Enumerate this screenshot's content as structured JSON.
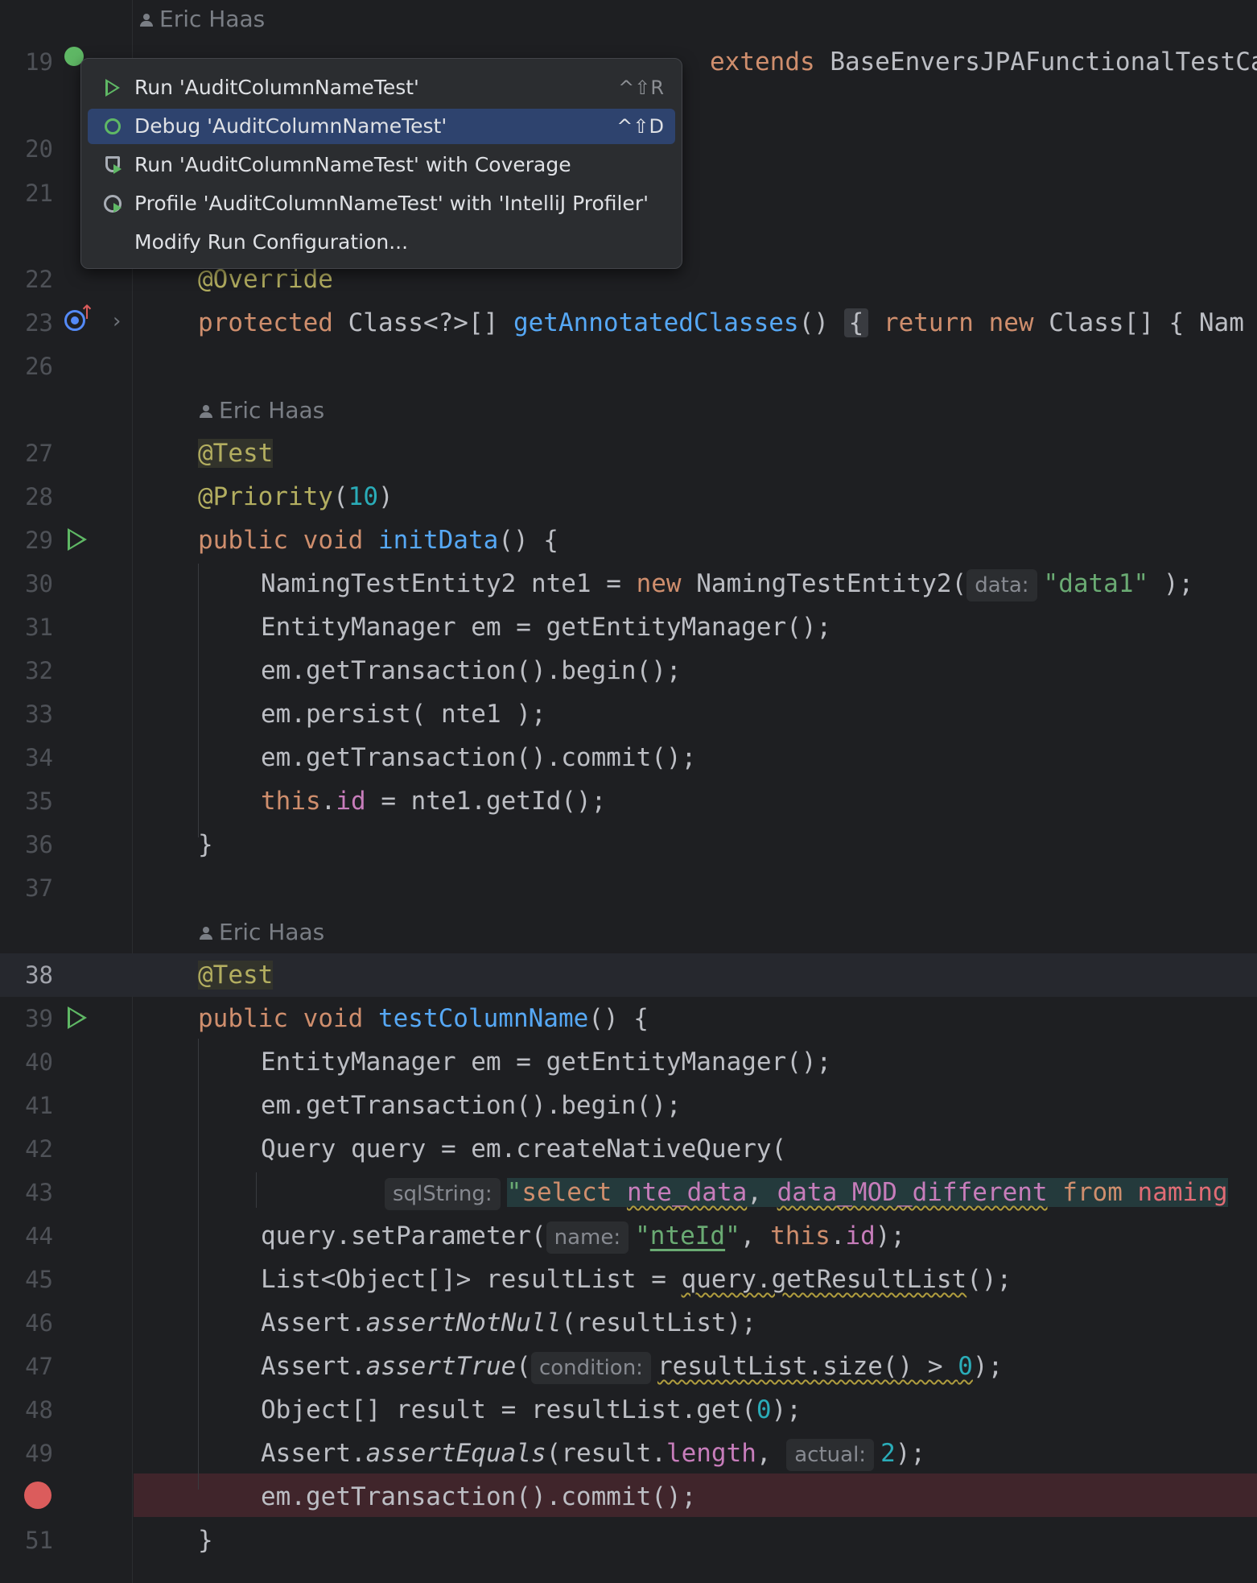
{
  "editor": {
    "author_name": "Eric Haas",
    "line_numbers": {
      "l19": "19",
      "l20": "20",
      "l21": "21",
      "l22": "22",
      "l23": "23",
      "l26": "26",
      "l27": "27",
      "l28": "28",
      "l29": "29",
      "l30": "30",
      "l31": "31",
      "l32": "32",
      "l33": "33",
      "l34": "34",
      "l35": "35",
      "l36": "36",
      "l37": "37",
      "l38": "38",
      "l39": "39",
      "l40": "40",
      "l41": "41",
      "l42": "42",
      "l43": "43",
      "l44": "44",
      "l45": "45",
      "l46": "46",
      "l47": "47",
      "l48": "48",
      "l49": "49",
      "l51": "51"
    },
    "code": {
      "l19_a": "extends",
      "l19_b": " BaseEnversJPAFunctionalTestCase",
      "l22": "@Override",
      "l23_a": "protected",
      "l23_b": " Class<?>[] ",
      "l23_c": "getAnnotatedClasses",
      "l23_d": "() ",
      "l23_e": "{",
      "l23_f": " ",
      "l23_g": "return",
      "l23_h": " ",
      "l23_i": "new",
      "l23_j": " Class[] { Nam",
      "l27": "@Test",
      "l28_a": "@Priority",
      "l28_b": "(",
      "l28_c": "10",
      "l28_d": ")",
      "l29_a": "public",
      "l29_b": " ",
      "l29_c": "void",
      "l29_d": " ",
      "l29_e": "initData",
      "l29_f": "() {",
      "l30_a": "NamingTestEntity2 nte1 = ",
      "l30_b": "new",
      "l30_c": " NamingTestEntity2(",
      "l30_hint": "data:",
      "l30_d": "\"data1\"",
      "l30_e": " );",
      "l31": "EntityManager em = getEntityManager();",
      "l32": "em.getTransaction().begin();",
      "l33": "em.persist( nte1 );",
      "l34": "em.getTransaction().commit();",
      "l35_a": "this",
      "l35_b": ".",
      "l35_c": "id",
      "l35_d": " = nte1.getId();",
      "l36": "}",
      "l38": "@Test",
      "l39_a": "public",
      "l39_b": " ",
      "l39_c": "void",
      "l39_d": " ",
      "l39_e": "testColumnName",
      "l39_f": "() {",
      "l40": "EntityManager em = getEntityManager();",
      "l41": "em.getTransaction().begin();",
      "l42": "Query query = em.createNativeQuery(",
      "l43_hint": "sqlString:",
      "l43_a": "\"",
      "l43_b": "select ",
      "l43_c": "nte_data",
      "l43_d": ", ",
      "l43_e": "data_MOD_different",
      "l43_f": " ",
      "l43_g": "from",
      "l43_h": " naming",
      "l44_a": "query.setParameter(",
      "l44_hint": "name:",
      "l44_b": "\"",
      "l44_c": "nteId",
      "l44_d": "\"",
      "l44_e": ", ",
      "l44_f": "this",
      "l44_g": ".",
      "l44_h": "id",
      "l44_i": ");",
      "l45_a": "List<Object[]> resultList = ",
      "l45_b": "query.getResultList",
      "l45_c": "();",
      "l46_a": "Assert.",
      "l46_b": "assertNotNull",
      "l46_c": "(resultList);",
      "l47_a": "Assert.",
      "l47_b": "assertTrue",
      "l47_c": "(",
      "l47_hint": "condition:",
      "l47_d": "resultList.size() > ",
      "l47_e": "0",
      "l47_f": ");",
      "l48_a": "Object[] result = resultList.get(",
      "l48_b": "0",
      "l48_c": ");",
      "l49_a": "Assert.",
      "l49_b": "assertEquals",
      "l49_c": "(result.",
      "l49_d": "length",
      "l49_e": ", ",
      "l49_hint": "actual:",
      "l49_f": "2",
      "l49_g": ");",
      "l50": "em.getTransaction().commit();",
      "l51": "}"
    }
  },
  "popup": {
    "items": [
      {
        "label": "Run 'AuditColumnNameTest'",
        "shortcut": "^⇧R",
        "icon": "run-icon"
      },
      {
        "label": "Debug 'AuditColumnNameTest'",
        "shortcut": "^⇧D",
        "icon": "debug-icon"
      },
      {
        "label": "Run 'AuditColumnNameTest' with Coverage",
        "shortcut": "",
        "icon": "coverage-icon"
      },
      {
        "label": "Profile 'AuditColumnNameTest' with 'IntelliJ Profiler'",
        "shortcut": "",
        "icon": "profiler-icon"
      },
      {
        "label": "Modify Run Configuration...",
        "shortcut": "",
        "icon": ""
      }
    ]
  },
  "colors": {
    "background": "#1e1f22",
    "keyword": "#cf8e6d",
    "function": "#56a8f5",
    "string": "#6aab73",
    "number": "#2aacb8",
    "annotation": "#b3ae60",
    "field": "#c77dbb",
    "selection": "#2e436e",
    "breakpoint": "#db5c5c",
    "run_gutter": "#5fb865"
  }
}
